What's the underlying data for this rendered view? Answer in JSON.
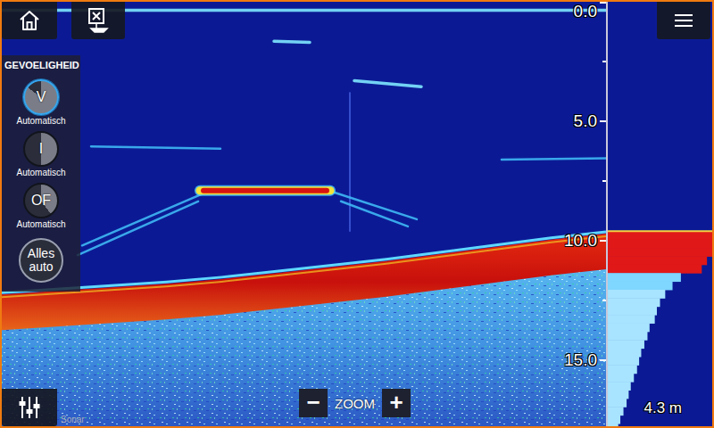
{
  "screen": {
    "mode_label": "Sonar"
  },
  "sensitivity": {
    "title": "GEVOELIGHEID",
    "controls": [
      {
        "symbol": "V",
        "mode": "Automatisch",
        "level": 0.85,
        "selected": true
      },
      {
        "symbol": "I",
        "mode": "Automatisch",
        "level": 0.5,
        "selected": false
      },
      {
        "symbol": "OF",
        "mode": "Automatisch",
        "level": 0.4,
        "selected": false
      }
    ],
    "all_auto": "Alles auto"
  },
  "depth_scale": {
    "ticks": [
      "0.0",
      "5.0",
      "10.0",
      "15.0"
    ]
  },
  "zoom": {
    "label": "ZOOM",
    "decrease": "−",
    "increase": "+"
  },
  "depth_reading": "4.3 m",
  "sonar": {
    "pings": 677,
    "bottom_depth": [
      12.25,
      12.1,
      11.95,
      11.8,
      11.6,
      11.35,
      11.1,
      10.85,
      10.55,
      10.25,
      9.95,
      9.7
    ],
    "echoes": [
      {
        "ping_from": 0,
        "ping_to": 677,
        "depth_from": 0.35,
        "depth_to": 0.35,
        "strength": 0.6
      },
      {
        "ping_from": 305,
        "ping_to": 345,
        "depth_from": 1.65,
        "depth_to": 1.7,
        "strength": 0.5
      },
      {
        "ping_from": 395,
        "ping_to": 470,
        "depth_from": 3.3,
        "depth_to": 3.55,
        "strength": 0.5
      },
      {
        "ping_from": 100,
        "ping_to": 245,
        "depth_from": 6.05,
        "depth_to": 6.15,
        "strength": 0.35
      },
      {
        "ping_from": 560,
        "ping_to": 677,
        "depth_from": 6.6,
        "depth_to": 6.55,
        "strength": 0.4
      },
      {
        "ping_from": 390,
        "ping_to": 390,
        "depth_from": 3.8,
        "depth_to": 9.6,
        "strength": 0.2
      },
      {
        "ping_from": 90,
        "ping_to": 230,
        "depth_from": 10.2,
        "depth_to": 7.95,
        "strength": 0.4
      },
      {
        "ping_from": 85,
        "ping_to": 220,
        "depth_from": 10.6,
        "depth_to": 8.35,
        "strength": 0.35
      },
      {
        "ping_from": 370,
        "ping_to": 465,
        "depth_from": 7.95,
        "depth_to": 9.1,
        "strength": 0.4
      },
      {
        "ping_from": 380,
        "ping_to": 455,
        "depth_from": 8.35,
        "depth_to": 9.4,
        "strength": 0.35
      },
      {
        "ping_from": 222,
        "ping_to": 368,
        "depth_from": 7.9,
        "depth_to": 7.9,
        "strength": 1
      }
    ]
  },
  "a_scope": {
    "start_depth": 9.6,
    "step": 0.35,
    "levels": [
      1,
      1,
      1,
      0.95,
      0.9,
      0.7,
      0.62,
      0.55,
      0.5,
      0.47,
      0.45,
      0.4,
      0.38,
      0.35,
      0.32,
      0.3,
      0.28,
      0.25,
      0.22,
      0.2,
      0.18,
      0.15,
      0.12,
      0.1
    ]
  }
}
